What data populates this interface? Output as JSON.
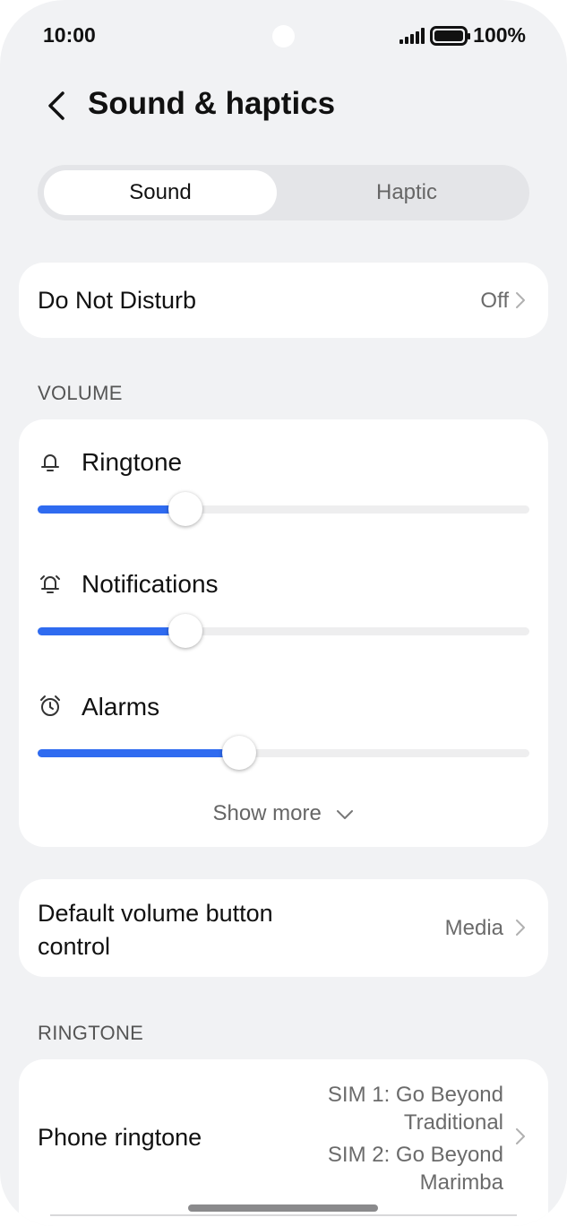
{
  "status": {
    "time": "10:00",
    "battery": "100%"
  },
  "header": {
    "title": "Sound & haptics"
  },
  "tabs": {
    "sound": "Sound",
    "haptic": "Haptic"
  },
  "dnd": {
    "label": "Do Not Disturb",
    "value": "Off"
  },
  "volume": {
    "section": "VOLUME",
    "ringtone": {
      "label": "Ringtone",
      "level": 0.3
    },
    "notifications": {
      "label": "Notifications",
      "level": 0.3
    },
    "alarms": {
      "label": "Alarms",
      "level": 0.41
    },
    "show_more": "Show more"
  },
  "volume_button": {
    "label_line1": "Default volume button",
    "label_line2": "control",
    "value": "Media"
  },
  "ringtone": {
    "section": "RINGTONE",
    "label": "Phone ringtone",
    "sim1_line1": "SIM 1: Go Beyond",
    "sim1_line2": "Traditional",
    "sim2_line1": "SIM 2: Go Beyond",
    "sim2_line2": "Marimba"
  },
  "colors": {
    "accent": "#2f6bf0",
    "background": "#f1f2f4"
  }
}
